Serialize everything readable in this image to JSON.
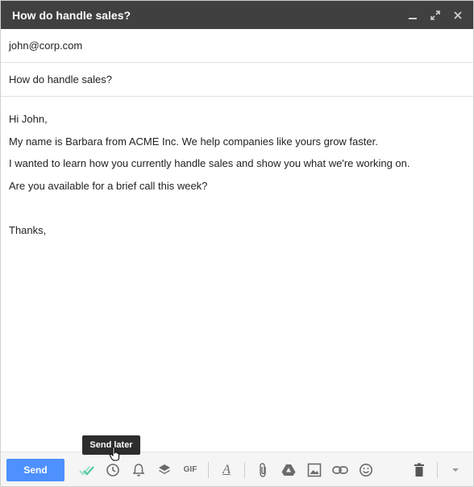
{
  "window": {
    "title": "How do handle sales?"
  },
  "compose": {
    "to_value": "john@corp.com",
    "subject_value": "How do handle sales?",
    "body_lines": [
      "Hi John,",
      "My name is Barbara from ACME Inc. We help companies like yours grow faster.",
      "I wanted to learn how you currently handle sales and show you what we're working on.",
      "Are you available for a brief call this week?",
      "",
      "Thanks,"
    ]
  },
  "toolbar": {
    "send_label": "Send",
    "tooltip_label": "Send later",
    "gif_label": "GIF",
    "format_label": "A"
  },
  "colors": {
    "titlebar": "#404040",
    "send_button": "#4d90fe",
    "check_accent": "#53c7a3",
    "icon_grey": "#6b6b6b"
  },
  "icons": [
    "minimize-icon",
    "expand-icon",
    "close-icon",
    "double-check-icon",
    "clock-icon",
    "bell-icon",
    "layers-icon",
    "gif-icon",
    "text-format-icon",
    "attachment-icon",
    "drive-icon",
    "image-icon",
    "link-icon",
    "emoji-icon",
    "trash-icon",
    "chevron-down-icon"
  ]
}
